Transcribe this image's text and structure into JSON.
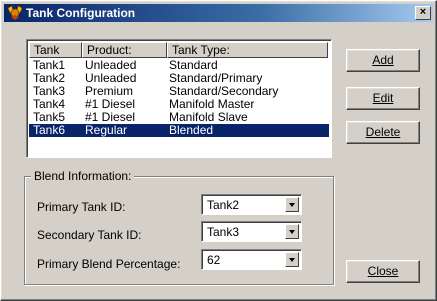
{
  "window": {
    "title": "Tank Configuration",
    "close_label": "×"
  },
  "list": {
    "columns": [
      "Tank",
      "Product:",
      "Tank Type:"
    ],
    "rows": [
      {
        "tank": "Tank1",
        "product": "Unleaded",
        "type": "Standard"
      },
      {
        "tank": "Tank2",
        "product": "Unleaded",
        "type": "Standard/Primary"
      },
      {
        "tank": "Tank3",
        "product": "Premium",
        "type": "Standard/Secondary"
      },
      {
        "tank": "Tank4",
        "product": "#1 Diesel",
        "type": "Manifold Master"
      },
      {
        "tank": "Tank5",
        "product": "#1 Diesel",
        "type": "Manifold Slave"
      },
      {
        "tank": "Tank6",
        "product": "Regular",
        "type": "Blended"
      }
    ],
    "selected_index": 5
  },
  "buttons": {
    "add": "Add",
    "edit": "Edit",
    "delete": "Delete",
    "close": "Close"
  },
  "blend": {
    "group_label": "Blend Information:",
    "primary_label": "Primary Tank ID:",
    "primary_value": "Tank2",
    "secondary_label": "Secondary Tank ID:",
    "secondary_value": "Tank3",
    "percent_label": "Primary Blend Percentage:",
    "percent_value": "62"
  },
  "colors": {
    "titlebar_start": "#0a246a",
    "selection": "#0a246a",
    "face": "#d4d0c8"
  }
}
